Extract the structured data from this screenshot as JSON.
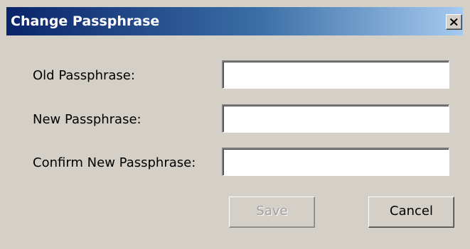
{
  "window": {
    "title": "Change Passphrase",
    "close_icon": "close-icon"
  },
  "form": {
    "old_label": "Old Passphrase:",
    "old_value": "",
    "new_label": "New Passphrase:",
    "new_value": "",
    "confirm_label": "Confirm New Passphrase:",
    "confirm_value": ""
  },
  "buttons": {
    "save_label": "Save",
    "save_enabled": false,
    "cancel_label": "Cancel"
  },
  "colors": {
    "dialog_background": "#d4d0c8",
    "titlebar_start": "#0a246a",
    "titlebar_end": "#a6caf0",
    "title_text": "#ffffff",
    "disabled_text": "#a0a0a0"
  }
}
